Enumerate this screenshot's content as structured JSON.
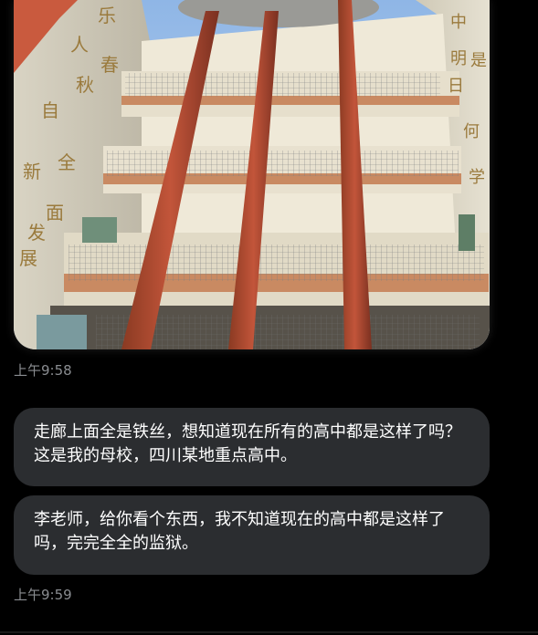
{
  "messages": [
    {
      "type": "image",
      "image_description_icon": "school-building-photo",
      "timestamp": "上午9:58"
    },
    {
      "type": "text",
      "text": "走廊上面全是铁丝，想知道现在所有的高中都是这样了吗？这是我的母校，四川某地重点高中。"
    },
    {
      "type": "text",
      "text": "李老师，给你看个东西，我不知道现在的高中都是这样了吗，完完全全的监狱。",
      "timestamp": "上午9:59"
    }
  ],
  "colors": {
    "background": "#000000",
    "bubble": "#2b2d30",
    "timestamp": "#8a8d91",
    "text": "#ffffff"
  }
}
